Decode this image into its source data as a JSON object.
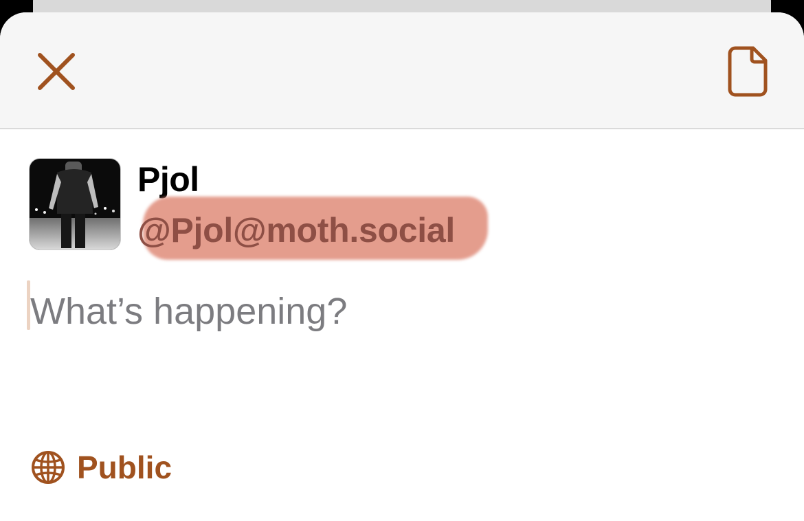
{
  "colors": {
    "accent": "#a0521f",
    "nav_background": "#f6f6f6",
    "placeholder": "#7c7c80",
    "redaction": "#e08c7a"
  },
  "header": {
    "close_icon": "close-icon",
    "draft_icon": "document-icon"
  },
  "account": {
    "display_name": "Pjol",
    "handle": "@Pjol@moth.social",
    "avatar_icon": "avatar-photo"
  },
  "compose": {
    "placeholder": "What’s happening?",
    "value": ""
  },
  "visibility": {
    "icon": "globe-icon",
    "label": "Public"
  }
}
